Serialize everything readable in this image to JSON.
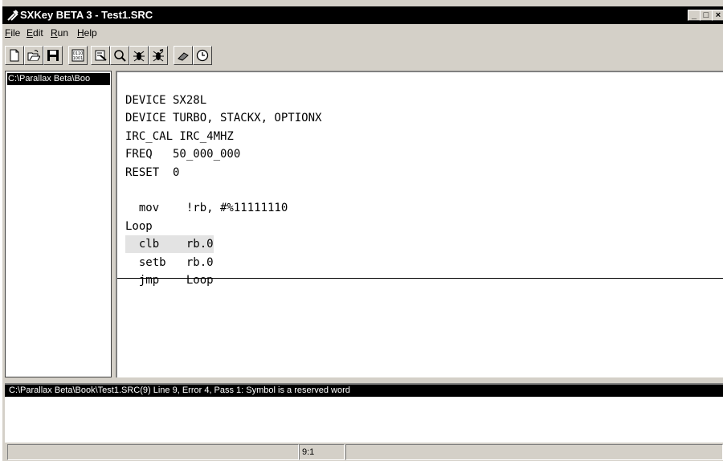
{
  "window": {
    "title": "SXKey BETA 3 - Test1.SRC",
    "app_icon": "sxkey-app-icon",
    "controls": [
      {
        "name": "minimize-icon",
        "glyph": "▁"
      },
      {
        "name": "maximize-icon",
        "glyph": "□"
      },
      {
        "name": "close-icon",
        "glyph": "✕"
      }
    ]
  },
  "menu": [
    {
      "name": "menu-file",
      "accel": "F",
      "rest": "ile"
    },
    {
      "name": "menu-edit",
      "accel": "E",
      "rest": "dit"
    },
    {
      "name": "menu-run",
      "accel": "R",
      "rest": "un"
    },
    {
      "name": "menu-help",
      "accel": "H",
      "rest": "elp"
    }
  ],
  "toolbar": {
    "buttons": [
      "new-file-icon",
      "open-folder-icon",
      "save-icon",
      "assemble-icon",
      "program-icon",
      "find-icon",
      "debug-icon",
      "debug-alt-icon",
      "eraser-icon",
      "clock-icon"
    ]
  },
  "file_pane": {
    "path": "C:\\Parallax Beta\\Boo"
  },
  "editor": {
    "lines": [
      "DEVICE SX28L",
      "DEVICE TURBO, STACKX, OPTIONX",
      "IRC_CAL IRC_4MHZ",
      "FREQ   50_000_000",
      "RESET  0",
      "",
      "  mov    !rb, #%11111110",
      "Loop",
      "  clb    rb.0",
      "  setb   rb.0",
      "  jmp    Loop"
    ],
    "highlighted_line": 8
  },
  "messages": {
    "error": "C:\\Parallax Beta\\Book\\Test1.SRC(9) Line 9, Error 4, Pass 1: Symbol is a reserved word"
  },
  "status": {
    "left": "",
    "position": "9:1",
    "right": ""
  },
  "colors": {
    "face": "#d4d0c8",
    "title_bar": "#000000",
    "selection": "#000000",
    "highlight_line": "#e3e3e3"
  }
}
